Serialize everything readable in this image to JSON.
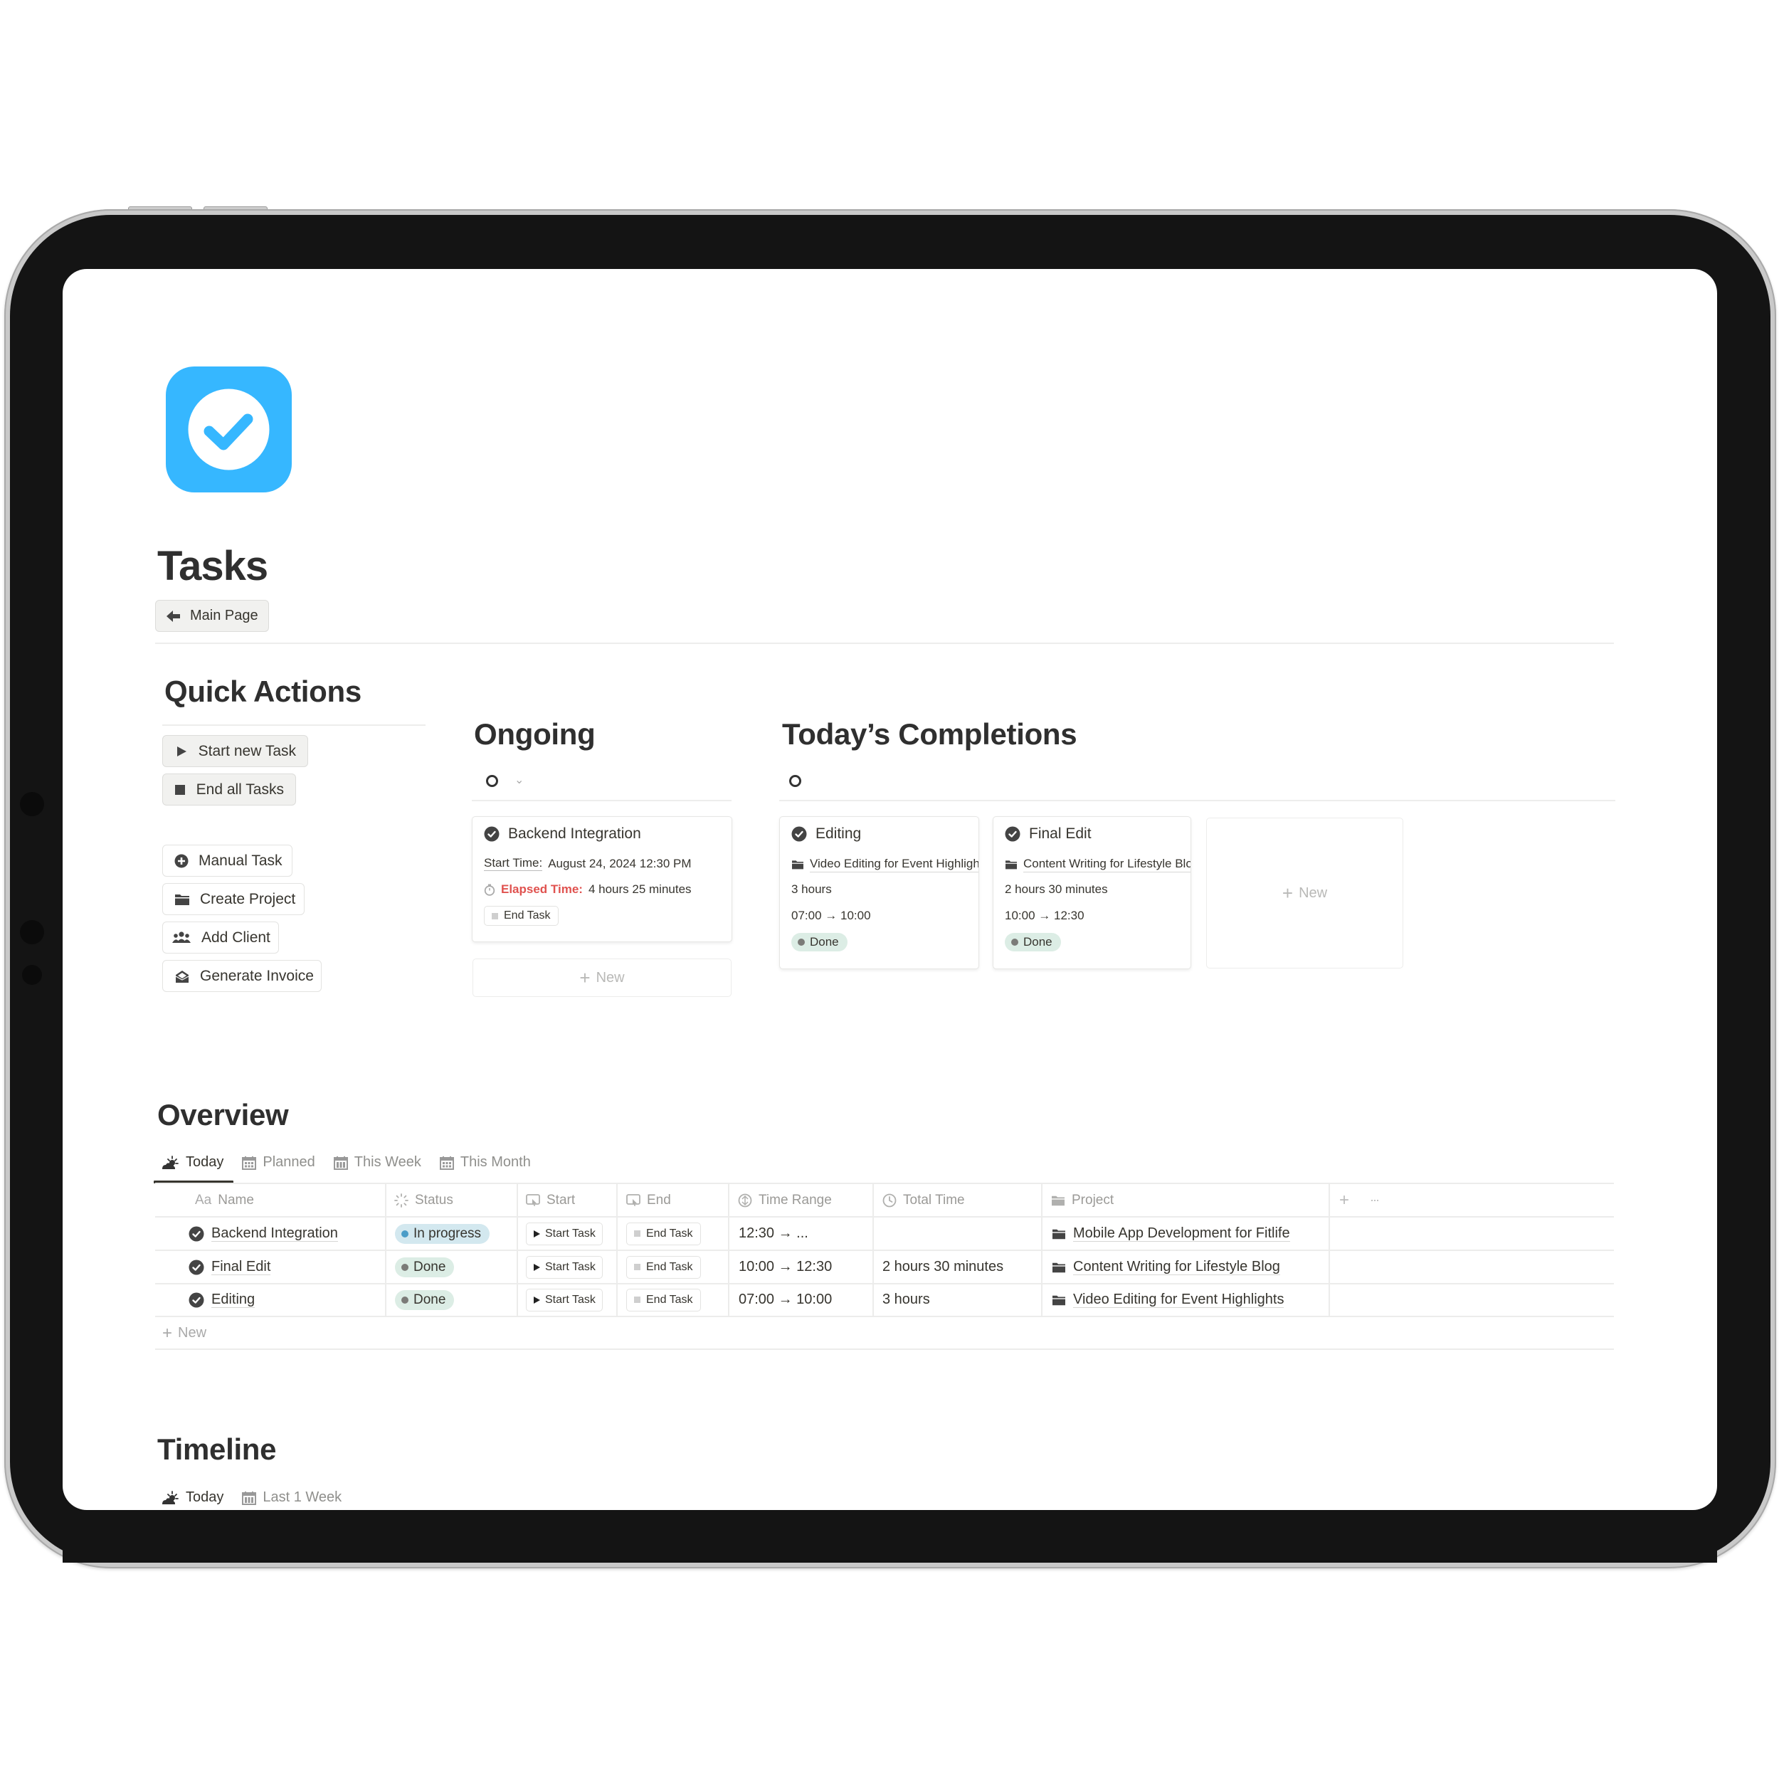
{
  "page": {
    "title": "Tasks",
    "icon": "check-circle-icon",
    "back_button": {
      "label": "Main Page",
      "icon": "arrow-left-icon"
    }
  },
  "quick_actions": {
    "title": "Quick Actions",
    "primary": [
      {
        "label": "Start new Task",
        "icon": "play-icon"
      },
      {
        "label": "End all Tasks",
        "icon": "stop-icon"
      }
    ],
    "secondary": [
      {
        "label": "Manual Task",
        "icon": "plus-circle-icon"
      },
      {
        "label": "Create Project",
        "icon": "folder-icon"
      },
      {
        "label": "Add Client",
        "icon": "people-icon"
      },
      {
        "label": "Generate Invoice",
        "icon": "invoice-icon"
      }
    ]
  },
  "ongoing": {
    "title": "Ongoing",
    "filter_icon": "circle-icon",
    "cards": [
      {
        "name": "Backend Integration",
        "start_label": "Start Time:",
        "start_value": "August 24, 2024 12:30 PM",
        "elapsed_label": "Elapsed Time:",
        "elapsed_value": "4 hours 25 minutes",
        "button": "End Task"
      }
    ],
    "new_label": "New"
  },
  "completions": {
    "title": "Today’s Completions",
    "filter_icon": "circle-icon",
    "cards": [
      {
        "name": "Editing",
        "project": "Video Editing for Event Highlights",
        "total": "3 hours",
        "range": "07:00 → 10:00",
        "status": "Done"
      },
      {
        "name": "Final Edit",
        "project": "Content Writing for Lifestyle Blog",
        "total": "2 hours 30 minutes",
        "range": "10:00 → 12:30",
        "status": "Done"
      }
    ],
    "new_label": "New"
  },
  "overview": {
    "title": "Overview",
    "tabs": [
      {
        "label": "Today",
        "icon": "sun-cloud-icon",
        "active": true
      },
      {
        "label": "Planned",
        "icon": "calendar-icon"
      },
      {
        "label": "This Week",
        "icon": "calendar-icon"
      },
      {
        "label": "This Month",
        "icon": "calendar-icon"
      }
    ],
    "columns": [
      {
        "label": "Name",
        "icon": "Aa"
      },
      {
        "label": "Status",
        "icon": "status-icon"
      },
      {
        "label": "Start",
        "icon": "button-icon"
      },
      {
        "label": "End",
        "icon": "button-icon"
      },
      {
        "label": "Time Range",
        "icon": "formula-icon"
      },
      {
        "label": "Total Time",
        "icon": "clock-icon"
      },
      {
        "label": "Project",
        "icon": "folder-icon"
      }
    ],
    "rows": [
      {
        "name": "Backend Integration",
        "status": "In progress",
        "start_btn": "Start Task",
        "end_btn": "End Task",
        "range": "12:30 →  ...",
        "total": "",
        "project": "Mobile App Development for Fitlife"
      },
      {
        "name": "Final Edit",
        "status": "Done",
        "start_btn": "Start Task",
        "end_btn": "End Task",
        "range": "10:00 → 12:30",
        "total": "2 hours 30 minutes",
        "project": "Content Writing for Lifestyle Blog"
      },
      {
        "name": "Editing",
        "status": "Done",
        "start_btn": "Start Task",
        "end_btn": "End Task",
        "range": "07:00 → 10:00",
        "total": "3 hours",
        "project": "Video Editing for Event Highlights"
      }
    ],
    "new_label": "New",
    "add_column": "+",
    "more": "···"
  },
  "timeline": {
    "title": "Timeline",
    "tabs": [
      {
        "label": "Today",
        "icon": "sun-cloud-icon",
        "active": true
      },
      {
        "label": "Last 1 Week",
        "icon": "calendar-icon"
      }
    ]
  },
  "colors": {
    "brand_icon": "#36b7ff",
    "in_progress_bg": "#d3e8ef",
    "in_progress_dot": "#4a9cc7",
    "done_bg": "#dcede5",
    "done_dot": "#7b7b78",
    "elapsed_red": "#e0524f"
  }
}
